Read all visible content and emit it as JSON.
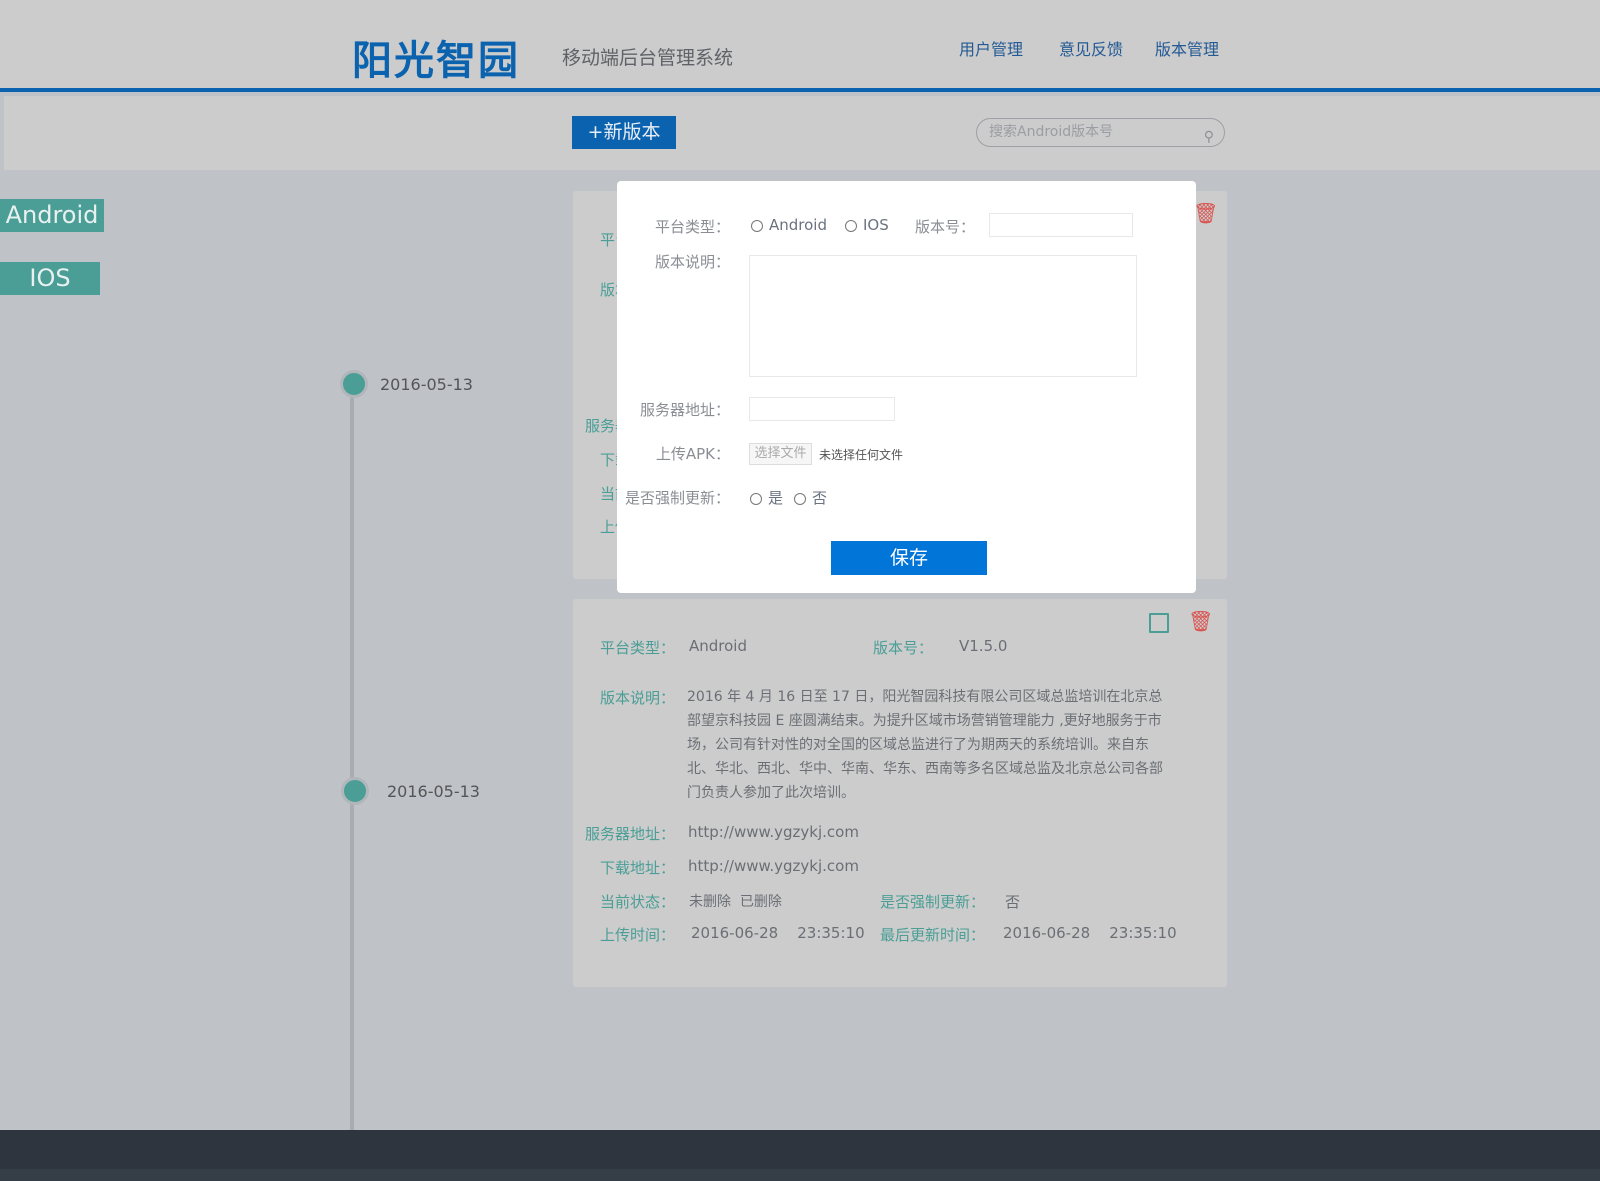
{
  "header": {
    "logo": "阳光智园",
    "subtitle": "移动端后台管理系统",
    "nav": [
      "用户管理",
      "意见反馈",
      "版本管理"
    ]
  },
  "toolbar": {
    "new_version": "+新版本",
    "search_placeholder": "搜索Android版本号"
  },
  "side_tabs": [
    "Android",
    "IOS"
  ],
  "timeline": {
    "dates": [
      "2016-05-13",
      "2016-05-13"
    ]
  },
  "labels": {
    "platform": "平台类型：",
    "version": "版本号：",
    "desc": "版本说明：",
    "server": "服务器地址：",
    "download": "下载地址：",
    "status": "当前状态：",
    "force": "是否强制更新：",
    "upload_time": "上传时间：",
    "updated_time": "最后更新时间："
  },
  "card": {
    "platform": "Android",
    "version": "V1.5.0",
    "desc": "2016 年 4 月 16 日至 17 日，阳光智园科技有限公司区域总监培训在北京总部望京科技园 E 座圆满结束。为提升区域市场营销管理能力 ,更好地服务于市场，公司有针对性的对全国的区域总监进行了为期两天的系统培训。来自东北、华北、西北、华中、华南、华东、西南等多名区域总监及北京总公司各部门负责人参加了此次培训。",
    "server": "http://www.ygzykj.com",
    "download": "http://www.ygzykj.com",
    "status": "未删除  已删除",
    "force": "否",
    "upload_time": "2016-06-28    23:35:10",
    "updated_time": "2016-06-28    23:35:10"
  },
  "modal": {
    "platform_label": "平台类型：",
    "opt_android": "Android",
    "opt_ios": "IOS",
    "version_label": "版本号：",
    "desc_label": "版本说明：",
    "server_label": "服务器地址：",
    "upload_label": "上传APK：",
    "choose_file": "选择文件",
    "no_file": "未选择任何文件",
    "force_label": "是否强制更新：",
    "yes": "是",
    "no": "否",
    "save": "保存"
  }
}
